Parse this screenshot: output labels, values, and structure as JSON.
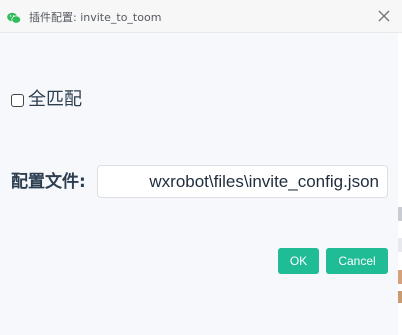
{
  "window": {
    "title": "插件配置: invite_to_toom"
  },
  "form": {
    "checkbox_label": "全匹配",
    "checkbox_checked": false,
    "file_label": "配置文件:",
    "file_value": "wxrobot\\files\\invite_config.json"
  },
  "buttons": {
    "ok_label": "OK",
    "cancel_label": "Cancel"
  },
  "colors": {
    "accent": "#1fbc95",
    "app_icon": "#2fbd5a"
  },
  "icons": {
    "app": "wechat-icon",
    "close": "close-icon"
  }
}
